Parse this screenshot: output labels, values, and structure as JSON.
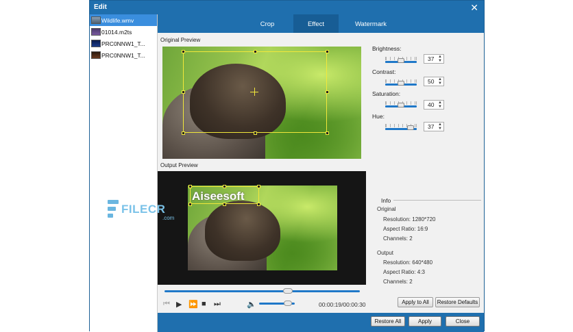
{
  "window": {
    "title": "Edit"
  },
  "files": [
    {
      "name": "Wildlife.wmv",
      "selected": true
    },
    {
      "name": "01014.m2ts",
      "selected": false
    },
    {
      "name": "PRC0NNW1_T...",
      "selected": false
    },
    {
      "name": "PRC0NNW1_T...",
      "selected": false
    }
  ],
  "tabs": [
    {
      "label": "Crop",
      "active": false
    },
    {
      "label": "Effect",
      "active": true
    },
    {
      "label": "Watermark",
      "active": false
    }
  ],
  "preview": {
    "original_label": "Original Preview",
    "output_label": "Output Preview",
    "watermark_text": "Aiseesoft",
    "seek_fraction": 0.63,
    "time": "00:00:19/00:00:30",
    "volume_fraction": 0.8
  },
  "effects": {
    "brightness": {
      "label": "Brightness:",
      "value": "37"
    },
    "contrast": {
      "label": "Contrast:",
      "value": "50"
    },
    "saturation": {
      "label": "Saturation:",
      "value": "40"
    },
    "hue": {
      "label": "Hue:",
      "value": "37"
    }
  },
  "info": {
    "title": "Info",
    "original": {
      "heading": "Original",
      "resolution": "Resolution: 1280*720",
      "aspect": "Aspect Ratio: 16:9",
      "channels": "Channels: 2"
    },
    "output": {
      "heading": "Output",
      "resolution": "Resolution: 640*480",
      "aspect": "Aspect Ratio: 4:3",
      "channels": "Channels: 2"
    }
  },
  "buttons": {
    "apply_to_all": "Apply to All",
    "restore_defaults": "Restore Defaults",
    "restore_all": "Restore All",
    "apply": "Apply",
    "close": "Close"
  },
  "brand": {
    "name": "FILECR",
    "suffix": ".com"
  }
}
